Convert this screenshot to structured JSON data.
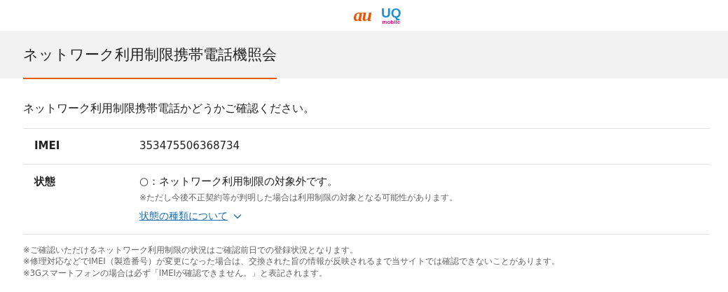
{
  "logos": [
    {
      "kind": "au",
      "text": "au"
    },
    {
      "kind": "uq",
      "text": "UQ",
      "sub": "mobile"
    }
  ],
  "page_title": "ネットワーク利用制限携帯電話機照会",
  "intro": "ネットワーク利用制限携帯電話かどうかご確認ください。",
  "rows": [
    {
      "label": "IMEI",
      "value": "353475506368734"
    },
    {
      "label": "状態",
      "value": "○：ネットワーク利用制限の対象外です。",
      "note": "※ただし今後不正契約等が判明した場合は利用制限の対象となる可能性があります。",
      "link": "状態の種類について",
      "expanded": false
    }
  ],
  "notes": [
    "※ご確認いただけるネットワーク利用制限の状況はご確認前日での登録状況となります。",
    "※修理対応などでIMEI（製造番号）が変更になった場合は、交換された旨の情報が反映されるまで当サイトでは確認できないことがあります。",
    "※3Gスマートフォンの場合は必ず「IMEIが確認できません。」と表記されます。"
  ]
}
